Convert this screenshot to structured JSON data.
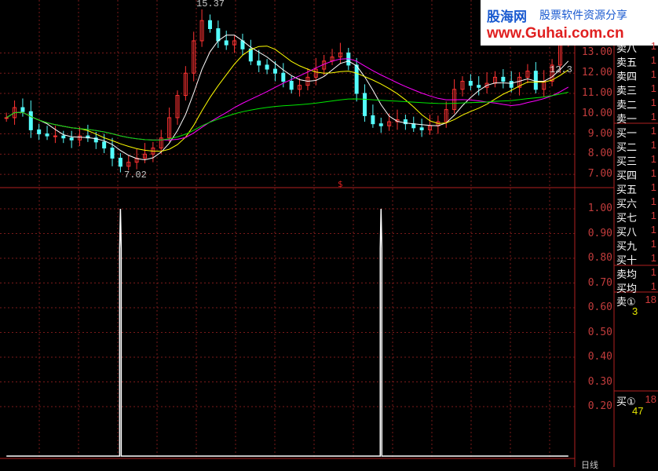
{
  "watermark": {
    "brand": "股海网",
    "slogan": "股票软件资源分享",
    "url": "www.Guhai.com.cn"
  },
  "price_axis": [
    "13.00",
    "12.00",
    "11.00",
    "10.00",
    "9.00",
    "8.00",
    "7.00"
  ],
  "indicator_axis": [
    "1.00",
    "0.90",
    "0.80",
    "0.70",
    "0.60",
    "0.50",
    "0.40",
    "0.30",
    "0.20"
  ],
  "marks": {
    "high": "15.37",
    "low": "7.02",
    "last_partial": "12.3"
  },
  "signal_label": "$",
  "order_book": {
    "sell_rows": [
      {
        "label": "卖八",
        "value": "1"
      },
      {
        "label": "卖五",
        "value": "1"
      },
      {
        "label": "卖四",
        "value": "1"
      },
      {
        "label": "卖三",
        "value": "1"
      },
      {
        "label": "卖二",
        "value": "1"
      },
      {
        "label": "卖一",
        "value": "1"
      }
    ],
    "buy_rows": [
      {
        "label": "买一",
        "value": "1"
      },
      {
        "label": "买二",
        "value": "1"
      },
      {
        "label": "买三",
        "value": "1"
      },
      {
        "label": "买四",
        "value": "1"
      },
      {
        "label": "买五",
        "value": "1"
      },
      {
        "label": "买六",
        "value": "1"
      },
      {
        "label": "买七",
        "value": "1"
      },
      {
        "label": "买八",
        "value": "1"
      },
      {
        "label": "买九",
        "value": "1"
      },
      {
        "label": "买十",
        "value": "1"
      }
    ],
    "avg_rows": [
      {
        "label": "卖均",
        "value": "1"
      },
      {
        "label": "买均",
        "value": "1"
      }
    ],
    "sell_total": {
      "label": "卖①",
      "value": "18",
      "sub": "3"
    },
    "buy_total": {
      "label": "买①",
      "value": "18",
      "sub": "47"
    }
  },
  "period_label": "日线",
  "colors": {
    "up": "#ff3232",
    "down": "#54fcfc",
    "ma5": "#ffffff",
    "ma10": "#ffff00",
    "ma20": "#ff00ff",
    "ma60": "#00e600",
    "grid": "#7a1a1a",
    "border": "#b02020"
  },
  "chart_data": [
    {
      "type": "candlestick",
      "title": "",
      "ylim": [
        6.5,
        15.5
      ],
      "series_close": [
        9.8,
        10.3,
        10.1,
        9.2,
        9.0,
        8.9,
        8.9,
        8.8,
        8.7,
        8.9,
        8.8,
        8.6,
        8.3,
        7.8,
        7.4,
        7.6,
        7.8,
        8.0,
        8.3,
        8.8,
        9.8,
        10.9,
        12.0,
        13.6,
        14.6,
        14.2,
        13.6,
        13.4,
        13.6,
        13.2,
        12.6,
        12.4,
        12.2,
        12.0,
        11.6,
        11.2,
        11.4,
        11.8,
        12.2,
        12.6,
        12.8,
        13.0,
        12.4,
        11.0,
        9.9,
        9.5,
        9.4,
        9.6,
        9.7,
        9.5,
        9.3,
        9.2,
        9.4,
        9.6,
        10.2,
        11.2,
        11.6,
        11.4,
        11.3,
        11.5,
        11.8,
        11.6,
        11.3,
        11.8,
        12.1,
        11.2,
        11.6,
        12.4,
        13.6,
        14.2
      ],
      "ma_series": [
        {
          "name": "MA5"
        },
        {
          "name": "MA10"
        },
        {
          "name": "MA20"
        },
        {
          "name": "MA60"
        }
      ]
    },
    {
      "type": "line",
      "title": "",
      "ylim": [
        0,
        1
      ],
      "x_count": 70,
      "spikes_at": [
        14,
        46
      ],
      "values_desc": "binary signal, 1 at spikes else 0"
    }
  ]
}
